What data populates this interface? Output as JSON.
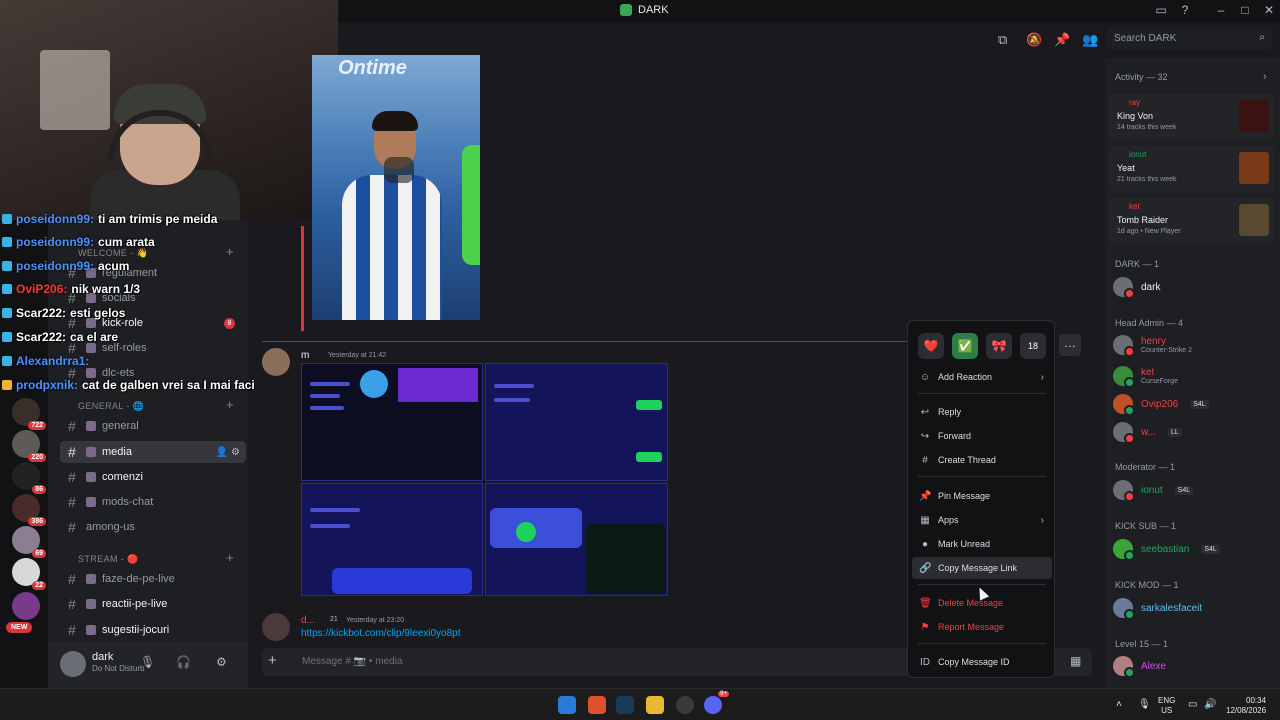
{
  "window": {
    "title": "DARK",
    "min_icon": "minimize-icon",
    "max_icon": "maximize-icon",
    "close_icon": "close-icon"
  },
  "stream_chat": [
    {
      "user": "poseidonn99:",
      "msg": "ti am trimis pe meida"
    },
    {
      "user": "poseidonn99:",
      "msg": "cum arata"
    },
    {
      "user": "poseidonn99:",
      "msg": "acum"
    },
    {
      "user": "OviP206:",
      "msg": "nik warn 1/3",
      "red": true
    },
    {
      "user": "Scar222:",
      "msg": "esti gelos"
    },
    {
      "user": "Scar222:",
      "msg": "ca el are"
    },
    {
      "user": "Alexandrra1:",
      "msg": ""
    },
    {
      "user": "prodpxnik:",
      "msg": "cat de galben vrei sa I mai faci"
    }
  ],
  "servers": [
    {
      "badge": "722"
    },
    {
      "badge": "220"
    },
    {
      "badge": "86"
    },
    {
      "badge": "386"
    },
    {
      "badge": "69"
    },
    {
      "badge": "22"
    },
    {
      "badge": ""
    },
    {
      "badge": ""
    }
  ],
  "new_badge": "NEW",
  "sidebar": {
    "cat_welcome": "WELCOME - 👋",
    "welcome_channels": [
      "regulament",
      "socials",
      "kick-role",
      "self-roles",
      "dlc-ets"
    ],
    "kick_role_mentions": "8",
    "cat_general": "GENERAL - 🌐",
    "general_channels": [
      "general",
      "media",
      "comenzi",
      "mods-chat",
      "among-us"
    ],
    "cat_stream": "STREAM - 🔴",
    "stream_channels": [
      "faze-de-pe-live",
      "reactii-pe-live",
      "sugestii-jocuri"
    ]
  },
  "user_panel": {
    "name": "dark",
    "status": "Do Not Disturb"
  },
  "search": {
    "placeholder": "Search DARK"
  },
  "messages": [
    {
      "name": "m",
      "time": "Yesterday at 21:42"
    },
    {
      "name": "d...",
      "extra": "21",
      "time": "Yesterday at 23:20",
      "link": "https://kickbot.com/clip/9leexi0yo8pt"
    }
  ],
  "post_image": {
    "brand": "Ontime"
  },
  "composer": {
    "placeholder": "Message # 📷 • media"
  },
  "context_menu": {
    "reactions": [
      "❤️",
      "✅",
      "🎀",
      "18"
    ],
    "items": [
      {
        "label": "Add Reaction",
        "icon": "smile-plus-icon",
        "submenu": true
      },
      {
        "label": "Reply",
        "icon": "reply-icon"
      },
      {
        "label": "Forward",
        "icon": "forward-icon"
      },
      {
        "label": "Create Thread",
        "icon": "thread-icon"
      },
      {
        "label": "Pin Message",
        "icon": "pin-icon"
      },
      {
        "label": "Apps",
        "icon": "apps-icon",
        "submenu": true
      },
      {
        "label": "Mark Unread",
        "icon": "mark-unread-icon"
      },
      {
        "label": "Copy Message Link",
        "icon": "link-icon"
      },
      {
        "label": "Delete Message",
        "icon": "trash-icon",
        "danger": true
      },
      {
        "label": "Report Message",
        "icon": "flag-icon",
        "danger": true
      },
      {
        "label": "Copy Message ID",
        "icon": "id-icon"
      }
    ]
  },
  "members": {
    "activity_header": "Activity — 32",
    "activities": [
      {
        "user": "ray",
        "title": "King Von",
        "sub": "14 tracks this week",
        "user_color": "#f23f43"
      },
      {
        "user": "ionut",
        "title": "Yeat",
        "sub": "21 tracks this week",
        "user_color": "#23a55a"
      },
      {
        "user": "ket",
        "title": "Tomb Raider",
        "sub": "1d ago  •  New Player",
        "user_color": "#f23f43"
      }
    ],
    "groups": [
      {
        "header": "DARK — 1",
        "members": [
          {
            "name": "dark",
            "color": "#f2f3f5"
          }
        ]
      },
      {
        "header": "Head Admin — 4",
        "members": [
          {
            "name": "henry",
            "sub": "Counter-Strike 2",
            "color": "#f23f43"
          },
          {
            "name": "ket",
            "sub": "CurseForge",
            "color": "#f23f43"
          },
          {
            "name": "Ovip206",
            "tag": "S4L",
            "color": "#f23f43"
          },
          {
            "name": "w...",
            "tag": "LL",
            "color": "#f23f43"
          }
        ]
      },
      {
        "header": "Moderator — 1",
        "members": [
          {
            "name": "ionut",
            "tag": "S4L",
            "color": "#23a55a"
          }
        ]
      },
      {
        "header": "KICK SUB — 1",
        "members": [
          {
            "name": "seebastian",
            "tag": "S4L",
            "color": "#23a55a"
          }
        ]
      },
      {
        "header": "KICK MOD — 1",
        "members": [
          {
            "name": "sarkalesfaceit",
            "color": "#5bc0f0"
          }
        ]
      },
      {
        "header": "Level 15 — 1",
        "members": [
          {
            "name": "Alexe",
            "color": "#d946ef"
          }
        ]
      }
    ]
  },
  "taskbar": {
    "lang": "ENG",
    "region": "US",
    "time": "00:34",
    "date": "12/08/2026",
    "discord_badge": "9+"
  },
  "colors": {
    "accent": "#5865f2",
    "danger": "#f23f43",
    "online": "#23a55a",
    "link": "#00a8fc"
  }
}
